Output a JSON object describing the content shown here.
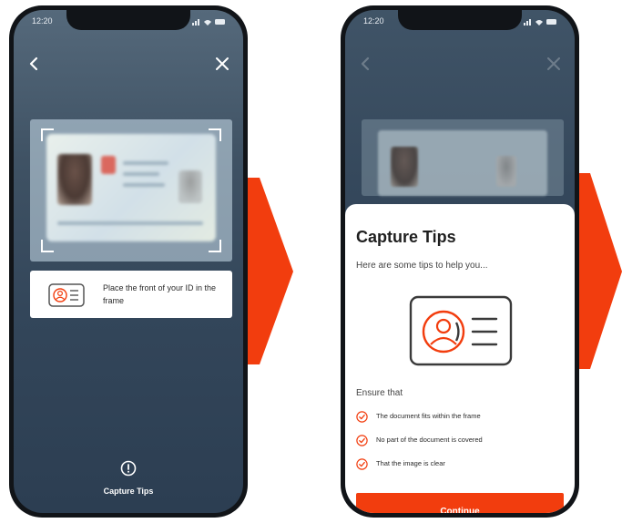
{
  "colors": {
    "accent": "#f23d0e",
    "screen_dark": "#33465a",
    "card_white": "#ffffff",
    "text_dark": "#1f1f1f"
  },
  "screen_one": {
    "status_time": "12:20",
    "instruction": "Place the front of your ID in the frame",
    "tips_link_label": "Capture Tips"
  },
  "screen_two": {
    "status_time": "12:20",
    "sheet": {
      "title": "Capture Tips",
      "subtitle": "Here are some tips to help you...",
      "ensure_label": "Ensure that",
      "tips": [
        "The document fits within the frame",
        "No part of the document is covered",
        "That the image is clear"
      ],
      "continue_label": "Continue"
    }
  },
  "icons": {
    "back": "chevron-left-icon",
    "close": "close-icon",
    "id_card": "id-card-icon",
    "info": "info-icon",
    "check": "check-circle-icon"
  }
}
